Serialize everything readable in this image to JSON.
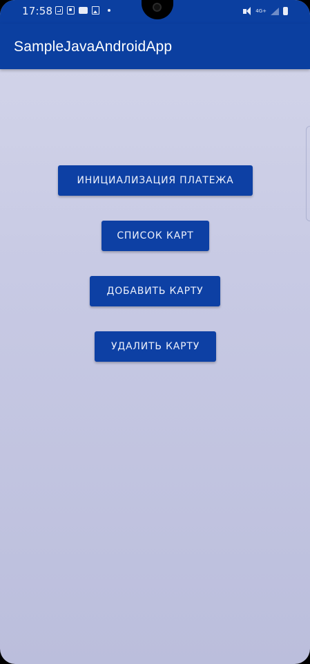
{
  "status_bar": {
    "time": "17:58",
    "network_label": "4G+",
    "notification_icons": [
      "g-icon",
      "chat-icon",
      "video-icon",
      "image-icon",
      "dot-icon"
    ],
    "system_icons": [
      "mute-icon",
      "lte-icon",
      "signal-icon",
      "battery-icon"
    ]
  },
  "app_bar": {
    "title": "SampleJavaAndroidApp"
  },
  "buttons": {
    "init_payment": "ИНИЦИАЛИЗАЦИЯ ПЛАТЕЖА",
    "card_list": "СПИСОК КАРТ",
    "add_card": "ДОБАВИТЬ КАРТУ",
    "delete_card": "УДАЛИТЬ КАРТУ"
  },
  "colors": {
    "primary": "#0b3fa0",
    "button": "#0d40a4",
    "background": "#c8cae4",
    "text_on_primary": "#ffffff"
  }
}
